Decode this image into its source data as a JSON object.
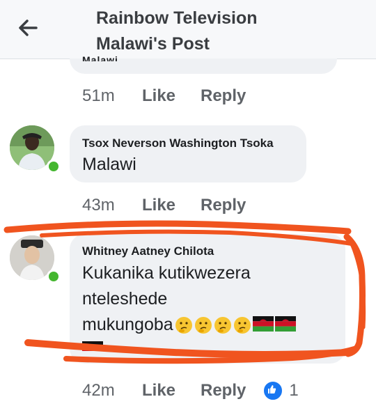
{
  "header": {
    "title_line1": "Rainbow Television",
    "title_line2": "Malawi's Post",
    "back_icon": "arrow-left-icon"
  },
  "comments": [
    {
      "partial_text": "Malawi.",
      "time": "51m",
      "like_label": "Like",
      "reply_label": "Reply"
    },
    {
      "author": "Tsox Neverson Washington Tsoka",
      "text": "Malawi",
      "time": "43m",
      "like_label": "Like",
      "reply_label": "Reply"
    },
    {
      "author": "Whitney Aatney Chilota",
      "text_line1": "Kukanika kutikwezera",
      "text_line2": "nteleshede",
      "text_line3": "mukungoba",
      "emojis": [
        "thinking-face",
        "thinking-face",
        "thinking-face",
        "thinking-face",
        "malawi-flag",
        "malawi-flag"
      ],
      "time": "42m",
      "like_label": "Like",
      "reply_label": "Reply",
      "reaction_icon": "thumbs-up-icon",
      "reaction_count": "1"
    }
  ],
  "colors": {
    "annotation": "#f0541f",
    "online": "#44b62f",
    "bubble": "#eff1f4",
    "like_blue": "#1877f2"
  }
}
